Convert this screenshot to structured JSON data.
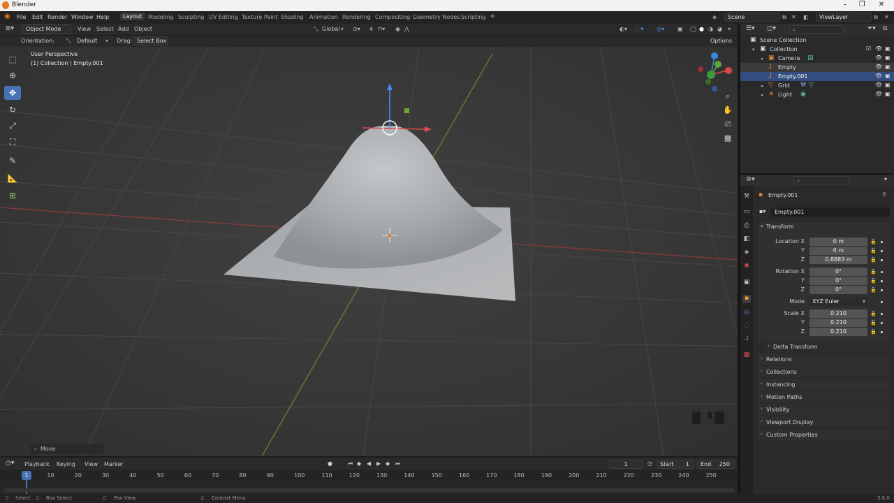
{
  "app": {
    "title": "Blender",
    "version": "3.0.0"
  },
  "menubar": {
    "menus": [
      "File",
      "Edit",
      "Render",
      "Window",
      "Help"
    ],
    "workspaces": [
      "Layout",
      "Modeling",
      "Sculpting",
      "UV Editing",
      "Texture Paint",
      "Shading",
      "Animation",
      "Rendering",
      "Compositing",
      "Geometry Nodes",
      "Scripting"
    ],
    "active_workspace": "Layout",
    "add_workspace": "+",
    "scene": "Scene",
    "view_layer": "ViewLayer"
  },
  "viewport_header": {
    "mode": "Object Mode",
    "menus": [
      "View",
      "Select",
      "Add",
      "Object"
    ],
    "transform_orientation": "Global",
    "options": "Options"
  },
  "tool_settings": {
    "orientation_label": "Orientation:",
    "orientation_value": "Default",
    "drag_label": "Drag:",
    "drag_value": "Select Box"
  },
  "viewport": {
    "perspective": "User Perspective",
    "collection_info": "(1) Collection | Empty.001",
    "last_operator": "Move",
    "gizmo_axes": [
      "X",
      "Y",
      "Z"
    ]
  },
  "toolbar": {
    "tools": [
      "select-box",
      "cursor",
      "move",
      "rotate",
      "scale",
      "transform",
      "annotate",
      "measure",
      "add-cube"
    ],
    "active_tool": "move"
  },
  "timeline": {
    "menus": [
      "Playback",
      "Keying",
      "View",
      "Marker"
    ],
    "current_frame": "1",
    "start_label": "Start",
    "start": "1",
    "end_label": "End",
    "end": "250",
    "ticks": [
      "1",
      "10",
      "20",
      "30",
      "40",
      "50",
      "60",
      "70",
      "80",
      "90",
      "100",
      "110",
      "120",
      "130",
      "140",
      "150",
      "160",
      "170",
      "180",
      "190",
      "200",
      "210",
      "220",
      "230",
      "240",
      "250"
    ]
  },
  "statusbar": {
    "items": [
      "Select",
      "Box Select",
      "Pan View",
      "Context Menu"
    ]
  },
  "outliner": {
    "scene_collection": "Scene Collection",
    "collection": "Collection",
    "items": [
      {
        "name": "Camera",
        "icon": "camera-icon",
        "state": "normal"
      },
      {
        "name": "Empty",
        "icon": "empty-icon",
        "state": "hover"
      },
      {
        "name": "Empty.001",
        "icon": "empty-icon",
        "state": "selected"
      },
      {
        "name": "Grid",
        "icon": "mesh-icon",
        "state": "normal"
      },
      {
        "name": "Light",
        "icon": "light-icon",
        "state": "normal"
      }
    ]
  },
  "properties": {
    "object_name": "Empty.001",
    "name_field": "Empty.001",
    "transform": {
      "title": "Transform",
      "location_label": "Location X",
      "location": [
        "0 m",
        "0 m",
        "0.8883 m"
      ],
      "rotation_label": "Rotation X",
      "rotation": [
        "0°",
        "0°",
        "0°"
      ],
      "mode_label": "Mode",
      "mode": "XYZ Euler",
      "scale_label": "Scale X",
      "scale": [
        "0.210",
        "0.210",
        "0.210"
      ],
      "y_label": "Y",
      "z_label": "Z"
    },
    "delta_transform": "Delta Transform",
    "panels": [
      "Relations",
      "Collections",
      "Instancing",
      "Motion Paths",
      "Visibility",
      "Viewport Display",
      "Custom Properties"
    ]
  },
  "colors": {
    "accent": "#4772b3",
    "selection": "#334d80",
    "x_axis": "#e0453f",
    "y_axis": "#7db83a",
    "z_axis": "#3a88e0"
  }
}
